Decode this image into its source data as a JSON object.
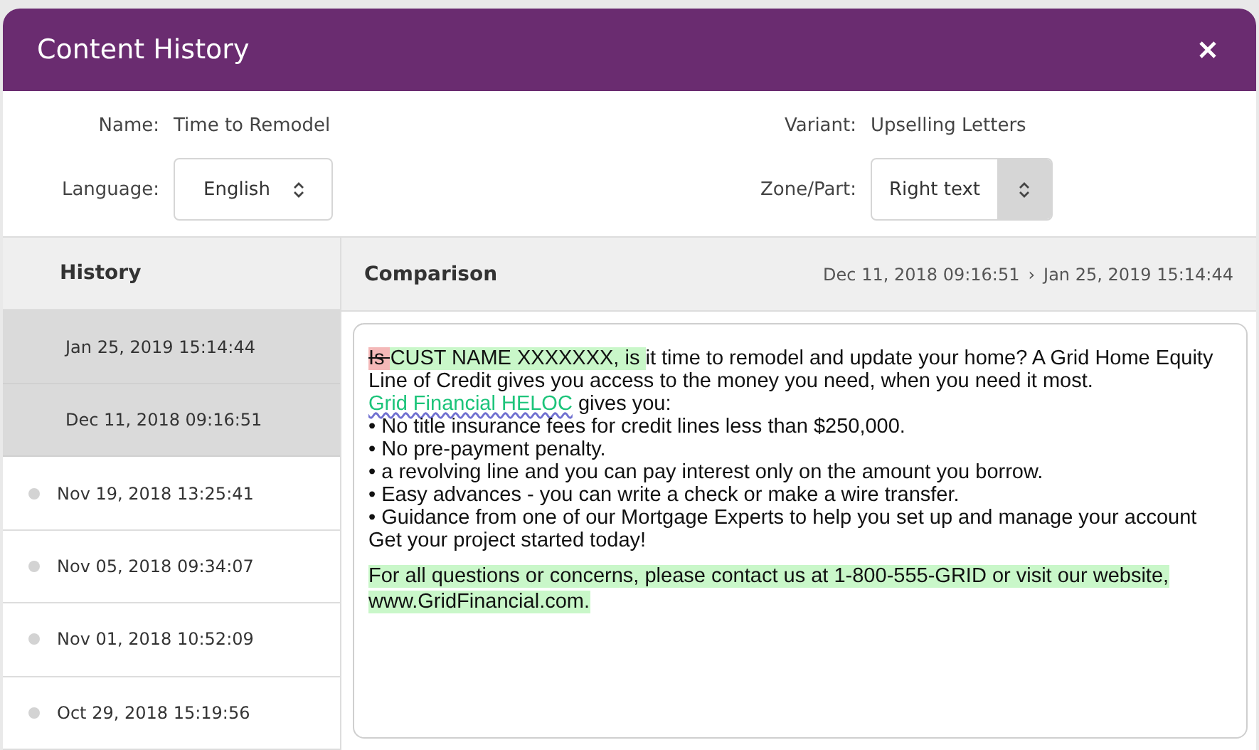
{
  "window": {
    "title": "Content History"
  },
  "info": {
    "name_label": "Name:",
    "name_value": "Time to Remodel",
    "variant_label": "Variant:",
    "variant_value": "Upselling Letters",
    "language_label": "Language:",
    "language_value": "English",
    "zone_label": "Zone/Part:",
    "zone_value": "Right text"
  },
  "history": {
    "heading": "History",
    "items": [
      {
        "date": "Jan 25, 2019 15:14:44",
        "selected": true
      },
      {
        "date": "Dec 11, 2018 09:16:51",
        "selected": true
      },
      {
        "date": "Nov 19, 2018 13:25:41",
        "selected": false
      },
      {
        "date": "Nov 05, 2018 09:34:07",
        "selected": false
      },
      {
        "date": "Nov 01, 2018 10:52:09",
        "selected": false
      },
      {
        "date": "Oct 29, 2018 15:19:56",
        "selected": false
      }
    ]
  },
  "comparison": {
    "heading": "Comparison",
    "from": "Dec 11, 2018 09:16:51",
    "separator": "›",
    "to": "Jan 25, 2019 15:14:44",
    "lines": [
      {
        "segments": [
          {
            "kind": "deleted",
            "text": "Is "
          },
          {
            "kind": "inserted",
            "text": "CUST NAME XXXXXXX, is "
          },
          {
            "kind": "plain",
            "text": "it time to remodel and update your home? A Grid Home Equity Line of Credit gives you access to the money you need, when you need it most."
          }
        ]
      },
      {
        "segments": [
          {
            "kind": "link",
            "text": "Grid Financial HELOC"
          },
          {
            "kind": "plain",
            "text": " gives you:"
          }
        ]
      },
      {
        "segments": [
          {
            "kind": "plain",
            "text": "• No title insurance fees for credit lines less than $250,000."
          }
        ]
      },
      {
        "segments": [
          {
            "kind": "plain",
            "text": "• No pre-payment penalty."
          }
        ]
      },
      {
        "segments": [
          {
            "kind": "plain",
            "text": "• a revolving line and you can pay interest only on the amount you borrow."
          }
        ]
      },
      {
        "segments": [
          {
            "kind": "plain",
            "text": "• Easy advances - you can write a check or make a wire transfer."
          }
        ]
      },
      {
        "segments": [
          {
            "kind": "plain",
            "text": "• Guidance from one of our Mortgage Experts to help you set up and manage your account"
          }
        ]
      },
      {
        "segments": [
          {
            "kind": "plain",
            "text": "Get your project started today!"
          }
        ]
      },
      {
        "gap": true,
        "segments": [
          {
            "kind": "inserted",
            "text": "For all questions or concerns, please contact us at 1-800-555-GRID or visit our website, www.GridFinancial.com."
          }
        ]
      }
    ]
  }
}
